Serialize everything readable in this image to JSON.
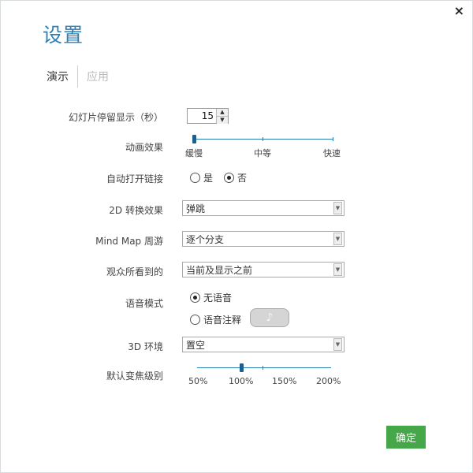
{
  "dialog": {
    "title": "设置",
    "close_glyph": "×"
  },
  "tabs": [
    {
      "label": "演示",
      "active": true
    },
    {
      "label": "应用",
      "active": false
    }
  ],
  "slide_duration": {
    "label": "幻灯片停留显示（秒）",
    "value": "15"
  },
  "animation": {
    "label": "动画效果",
    "options": [
      "缓慢",
      "中等",
      "快速"
    ],
    "selected": "缓慢"
  },
  "auto_open_links": {
    "label": "自动打开链接",
    "options": [
      "是",
      "否"
    ],
    "selected": "否"
  },
  "transition_2d": {
    "label": "2D 转换效果",
    "value": "弹跳"
  },
  "mind_map_tour": {
    "label": "Mind Map 周游",
    "value": "逐个分支"
  },
  "audience_sees": {
    "label": "观众所看到的",
    "value": "当前及显示之前"
  },
  "voice_mode": {
    "label": "语音模式",
    "options": [
      "无语音",
      "语音注释"
    ],
    "selected": "无语音",
    "note_button_icon": "music-note-icon"
  },
  "env_3d": {
    "label": "3D 环境",
    "value": "置空"
  },
  "default_zoom": {
    "label": "默认变焦级别",
    "ticks": [
      "50%",
      "100%",
      "150%",
      "200%"
    ],
    "selected": "100%"
  },
  "footer": {
    "ok_label": "确定"
  },
  "colors": {
    "accent": "#2a7fb6",
    "ok_button": "#45a749"
  }
}
